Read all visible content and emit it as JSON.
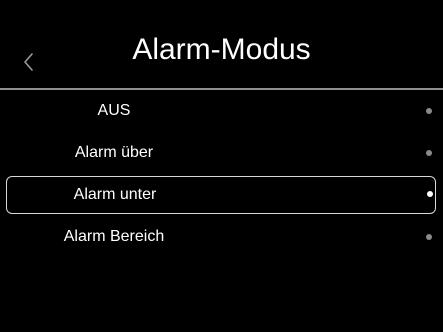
{
  "screen": {
    "title": "Alarm-Modus"
  },
  "navigation": {
    "back_icon": "chevron-left-icon"
  },
  "menu": {
    "items": [
      {
        "label": "AUS",
        "selected": false
      },
      {
        "label": "Alarm über",
        "selected": false
      },
      {
        "label": "Alarm unter",
        "selected": true
      },
      {
        "label": "Alarm Bereich",
        "selected": false
      }
    ]
  },
  "colors": {
    "background": "#000000",
    "text": "#ffffff",
    "divider": "#8f8f8f",
    "selection_border": "#d8d8d8",
    "dot_inactive": "#8a8a8a",
    "dot_active": "#ffffff"
  }
}
